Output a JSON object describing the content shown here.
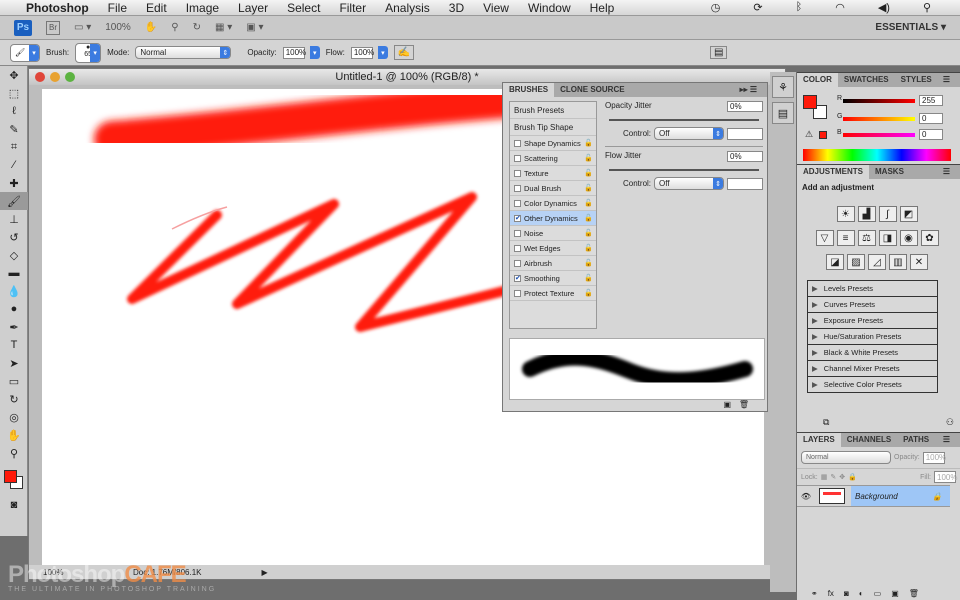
{
  "menubar": {
    "app": "Photoshop",
    "items": [
      "File",
      "Edit",
      "Image",
      "Layer",
      "Select",
      "Filter",
      "Analysis",
      "3D",
      "View",
      "Window",
      "Help"
    ]
  },
  "appbar": {
    "ps": "Ps",
    "br": "Br",
    "zoom": "100%",
    "workspace": "ESSENTIALS ▾"
  },
  "options": {
    "brush_label": "Brush:",
    "brush_size": "65",
    "mode_label": "Mode:",
    "mode": "Normal",
    "opacity_label": "Opacity:",
    "opacity": "100%",
    "flow_label": "Flow:",
    "flow": "100%"
  },
  "document": {
    "title": "Untitled-1 @ 100% (RGB/8) *",
    "zoom": "100%",
    "doc_info": "Doc: 1.76M/806.1K"
  },
  "brushes": {
    "tabs": [
      "BRUSHES",
      "CLONE SOURCE"
    ],
    "presets": "Brush Presets",
    "tip_shape": "Brush Tip Shape",
    "items": [
      {
        "label": "Shape Dynamics",
        "checked": false
      },
      {
        "label": "Scattering",
        "checked": false
      },
      {
        "label": "Texture",
        "checked": false
      },
      {
        "label": "Dual Brush",
        "checked": false
      },
      {
        "label": "Color Dynamics",
        "checked": false
      },
      {
        "label": "Other Dynamics",
        "checked": true
      },
      {
        "label": "Noise",
        "checked": false
      },
      {
        "label": "Wet Edges",
        "checked": false
      },
      {
        "label": "Airbrush",
        "checked": false
      },
      {
        "label": "Smoothing",
        "checked": true
      },
      {
        "label": "Protect Texture",
        "checked": false
      }
    ],
    "opacity_jitter_label": "Opacity Jitter",
    "opacity_jitter": "0%",
    "flow_jitter_label": "Flow Jitter",
    "flow_jitter": "0%",
    "control_label": "Control:",
    "control1": "Off",
    "control2": "Off"
  },
  "color": {
    "tabs": [
      "COLOR",
      "SWATCHES",
      "STYLES"
    ],
    "r": "255",
    "g": "0",
    "b": "0",
    "fg": "#ff1a0a"
  },
  "adjustments": {
    "tabs": [
      "ADJUSTMENTS",
      "MASKS"
    ],
    "heading": "Add an adjustment",
    "presets": [
      "Levels Presets",
      "Curves Presets",
      "Exposure Presets",
      "Hue/Saturation Presets",
      "Black & White Presets",
      "Channel Mixer Presets",
      "Selective Color Presets"
    ]
  },
  "layers": {
    "tabs": [
      "LAYERS",
      "CHANNELS",
      "PATHS"
    ],
    "blend": "Normal",
    "opacity_label": "Opacity:",
    "opacity": "100%",
    "lock_label": "Lock:",
    "fill_label": "Fill:",
    "fill": "100%",
    "layer_name": "Background"
  },
  "watermark": {
    "brand": "Photoshop",
    "brand2": "CAFE",
    "tagline": "THE ULTIMATE IN PHOTOSHOP TRAINING"
  }
}
